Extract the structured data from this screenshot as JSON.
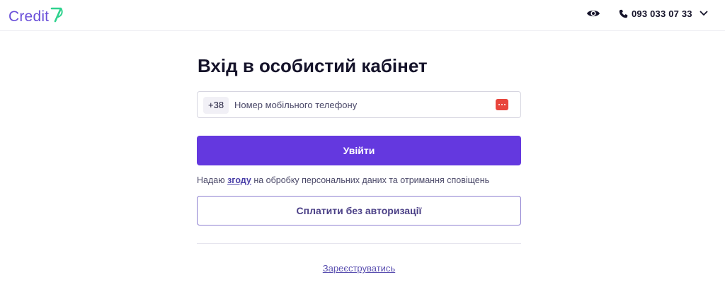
{
  "header": {
    "logo_text": "Credit",
    "logo_mark": "7",
    "visibility_icon": "eye-icon",
    "phone_icon": "phone-icon",
    "phone": "093 033 07 33",
    "dropdown_icon": "chevron-down-icon"
  },
  "login": {
    "title": "Вхід в особистий кабінет",
    "phone_prefix": "+38",
    "phone_placeholder": "Номер мобільного телефону",
    "phone_value": "",
    "password_manager_icon": "password-manager-icon",
    "submit_label": "Увійти",
    "consent_before": "Надаю ",
    "consent_link": "згоду",
    "consent_after": " на обробку персональних даних та отримання сповіщень",
    "pay_label": "Сплатити без авторизації",
    "register_label": "Зареєструватись"
  },
  "colors": {
    "brand": "#6a4fd9",
    "logo_mark": "#2fd28e",
    "primary_button": "#6438df",
    "password_icon": "#e8453c"
  }
}
